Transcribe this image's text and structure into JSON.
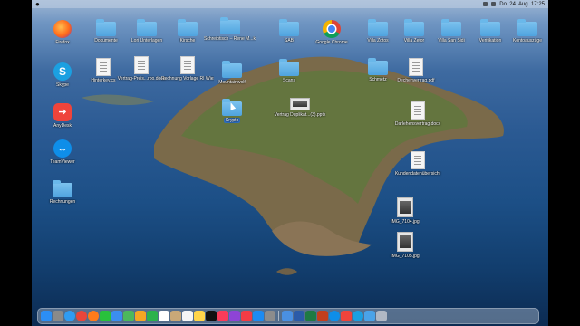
{
  "menubar": {
    "apple": "",
    "datetime": "Do. 24. Aug.  17:25"
  },
  "desktop": {
    "apps": [
      {
        "name": "firefox",
        "label": "Firefox",
        "kind": "firefox"
      },
      {
        "name": "skype",
        "label": "Skype",
        "kind": "skype",
        "glyph": "S"
      },
      {
        "name": "anydesk",
        "label": "AnyDesk",
        "kind": "anydesk",
        "glyph": "➔"
      },
      {
        "name": "teamviewer",
        "label": "TeamViewer",
        "kind": "teamviewer",
        "glyph": "↔"
      },
      {
        "name": "rechnungen",
        "label": "Rechnungen",
        "kind": "folder"
      }
    ],
    "top_row": [
      {
        "label": "Dokumente",
        "kind": "folder"
      },
      {
        "label": "Lori Unterlagen",
        "kind": "folder"
      },
      {
        "label": "Kirsche",
        "kind": "folder"
      },
      {
        "label": "Schreibtisch – Rene M...k Pro (7)",
        "kind": "folder"
      },
      {
        "label": "SAB",
        "kind": "folder"
      },
      {
        "label": "Google Chrome",
        "kind": "chrome"
      },
      {
        "label": "Villa Zotos",
        "kind": "folder"
      },
      {
        "label": "Villa Zetor",
        "kind": "folder"
      },
      {
        "label": "Villa San Sidi",
        "kind": "folder"
      },
      {
        "label": "Verifikation",
        "kind": "folder"
      },
      {
        "label": "Kontoauszüge",
        "kind": "folder"
      }
    ],
    "second_row": [
      {
        "label": "Hinterkey.cs",
        "kind": "doc"
      },
      {
        "label": "Vertrag-Preis...roo.docx",
        "kind": "doc"
      },
      {
        "label": "Rechnung Vorlage RI Wiese.xlsx",
        "kind": "doc"
      },
      {
        "label": "Mountainwolf",
        "kind": "folder"
      },
      {
        "label": "Scans",
        "kind": "folder"
      },
      {
        "label": "Schmetz",
        "kind": "folder"
      },
      {
        "label": "Dechenvertrag.pdf",
        "kind": "doc"
      }
    ],
    "misc": [
      {
        "label": "Crypto",
        "kind": "folder",
        "selected": true
      },
      {
        "label": "Vertrag Duplikat...(3).pptx",
        "kind": "doc"
      },
      {
        "label": "Darlehensvertrag.docx",
        "kind": "doc"
      },
      {
        "label": "Kundendatenübersicht",
        "kind": "doc"
      },
      {
        "label": "IMG_7104.jpg",
        "kind": "img"
      },
      {
        "label": "IMG_7105.jpg",
        "kind": "img"
      }
    ]
  },
  "dock": {
    "items": [
      "finder",
      "launchpad",
      "safari",
      "chrome",
      "firefox",
      "messages",
      "mail",
      "maps",
      "photos",
      "facetime",
      "calendar",
      "contacts",
      "reminders",
      "notes",
      "tv",
      "music",
      "podcasts",
      "news",
      "app-store",
      "settings",
      "preview",
      "word",
      "excel",
      "powerpoint",
      "teamviewer",
      "anydesk",
      "skype",
      "downloads",
      "trash"
    ],
    "colors": [
      "#2c8ef5",
      "#8a8a8a",
      "#2f9cf3",
      "#e9463a",
      "#ff7b1a",
      "#29c13c",
      "#3b8ef0",
      "#4cb85c",
      "#f4a623",
      "#2bb24c",
      "#ffffff",
      "#c9a878",
      "#f5f5f5",
      "#ffd54a",
      "#111111",
      "#fa3c5a",
      "#8e44d6",
      "#f23c45",
      "#1c8bf2",
      "#8c8c8c",
      "#4a90e2",
      "#2b5ba8",
      "#1f7a43",
      "#c43e1c",
      "#0e8ee9",
      "#ef443b",
      "#1ba0e1",
      "#4aa3e8",
      "#b0b8c4"
    ]
  }
}
